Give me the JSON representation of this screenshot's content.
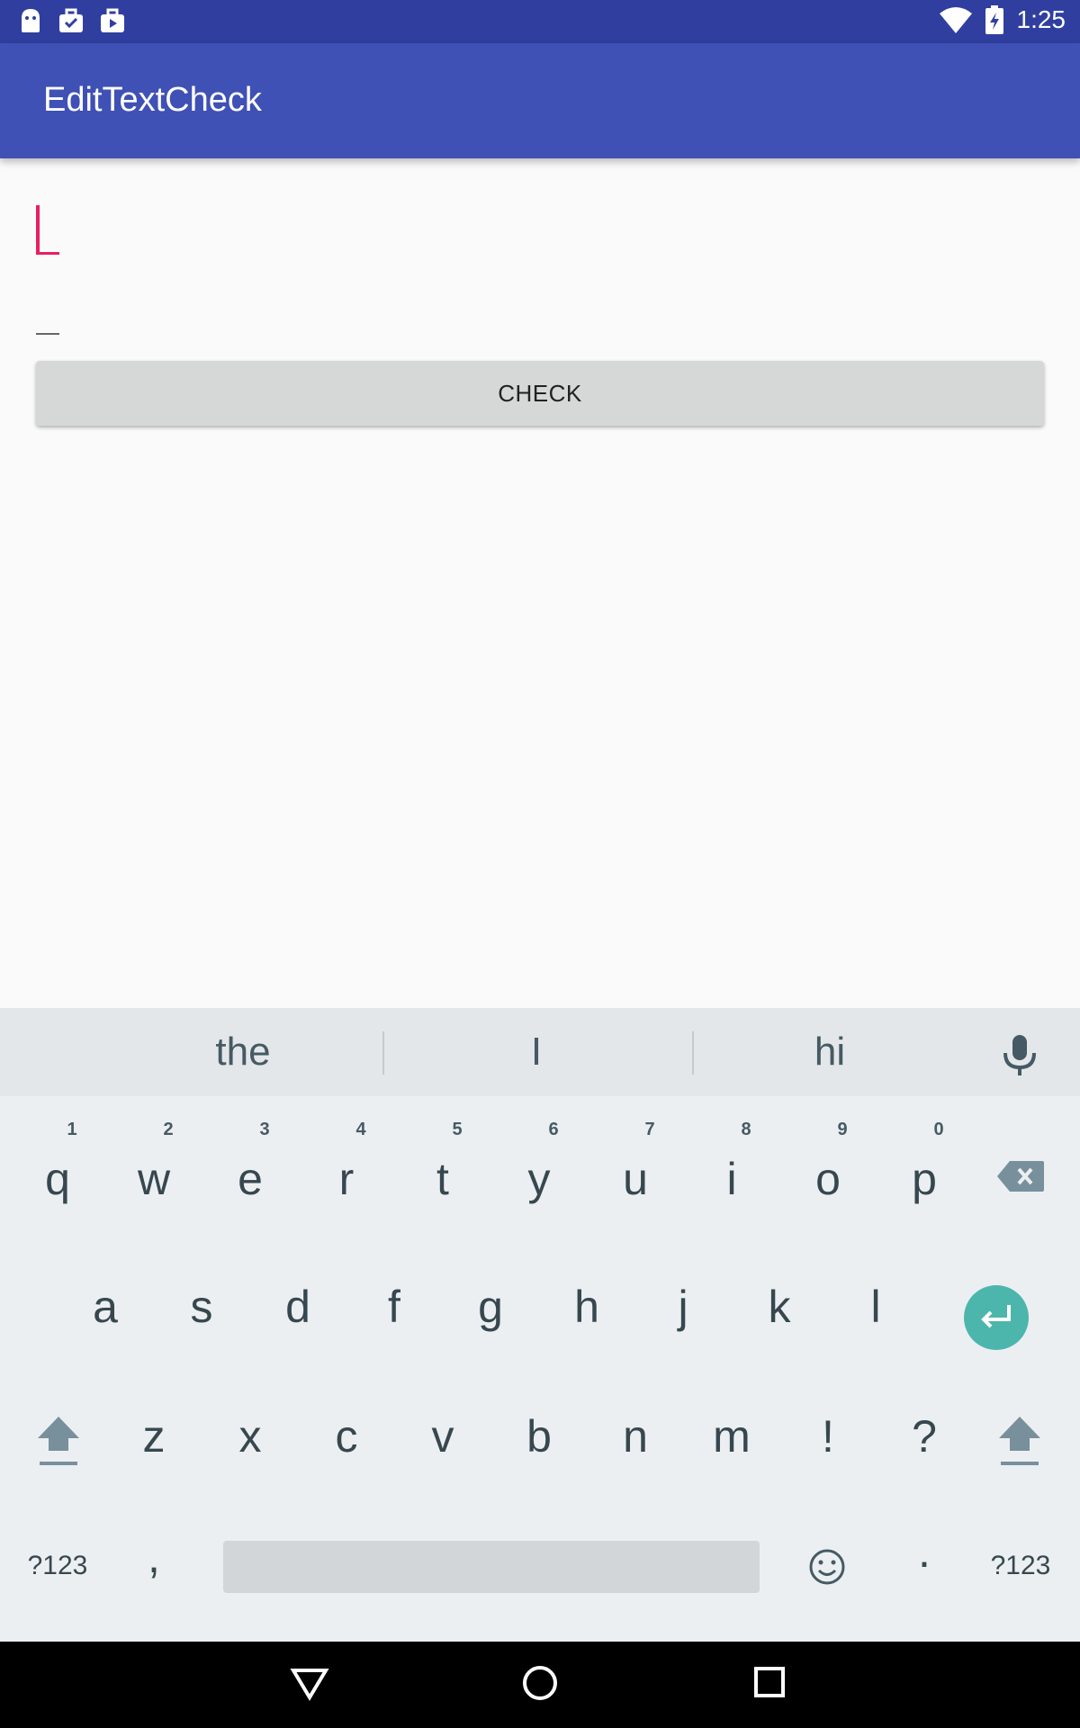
{
  "status_bar": {
    "time": "1:25",
    "left_icons": [
      "android-icon",
      "briefcase-check-icon",
      "briefcase-play-icon"
    ],
    "right_icons": [
      "wifi-icon",
      "battery-charging-icon"
    ]
  },
  "app_bar": {
    "title": "EditTextCheck"
  },
  "form": {
    "field1_value": "",
    "field2_value": "",
    "check_button_label": "CHECK"
  },
  "keyboard": {
    "suggestions": [
      "the",
      "I",
      "hi"
    ],
    "row1": [
      "q",
      "w",
      "e",
      "r",
      "t",
      "y",
      "u",
      "i",
      "o",
      "p"
    ],
    "row1_hints": [
      "1",
      "2",
      "3",
      "4",
      "5",
      "6",
      "7",
      "8",
      "9",
      "0"
    ],
    "row2": [
      "a",
      "s",
      "d",
      "f",
      "g",
      "h",
      "j",
      "k",
      "l"
    ],
    "row3": [
      "z",
      "x",
      "c",
      "v",
      "b",
      "n",
      "m",
      "!",
      "?"
    ],
    "row4": {
      "symbols_left": "?123",
      "comma": ",",
      "period": ".",
      "symbols_right": "?123"
    },
    "colors": {
      "enter_accent": "#4db6ac",
      "cursor_accent": "#e91e63"
    }
  },
  "colors": {
    "primary": "#3f51b5",
    "primary_dark": "#303f9f"
  }
}
